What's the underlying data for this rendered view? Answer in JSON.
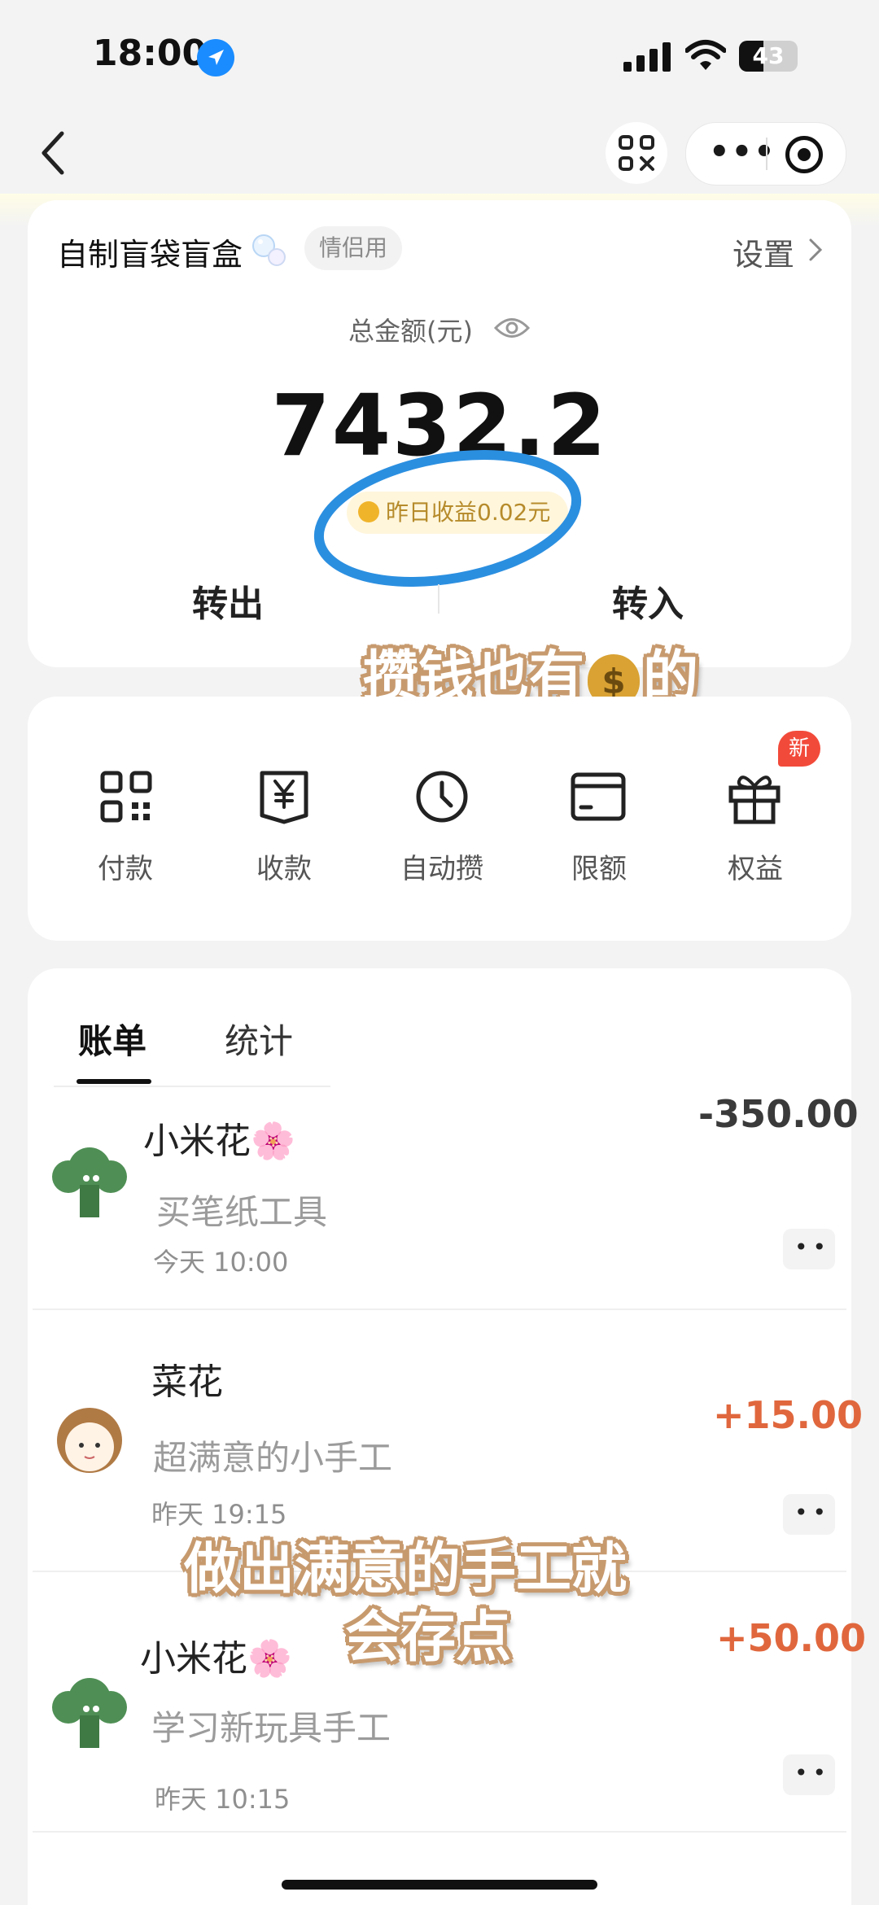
{
  "status_bar": {
    "time": "18:00",
    "battery": "43"
  },
  "account": {
    "name": "自制盲袋盲盒",
    "tag": "情侣用",
    "settings_label": "设置",
    "total_label": "总金额(元)",
    "total_amount": "7432.2",
    "yesterday_yield": "昨日收益0.02元",
    "transfer_out": "转出",
    "transfer_in": "转入"
  },
  "captions": {
    "line1_pre": "攒钱也有",
    "line1_post": "的",
    "line2": "做出满意的手工就",
    "line3": "会存点"
  },
  "quick_actions": [
    {
      "label": "付款",
      "icon": "qr-code-icon"
    },
    {
      "label": "收款",
      "icon": "receipt-yen-icon"
    },
    {
      "label": "自动攒",
      "icon": "clock-icon"
    },
    {
      "label": "限额",
      "icon": "card-icon"
    },
    {
      "label": "权益",
      "icon": "gift-icon"
    }
  ],
  "new_badge": "新",
  "tabs": [
    {
      "label": "账单"
    },
    {
      "label": "统计"
    }
  ],
  "transactions": [
    {
      "name": "小米花🌸",
      "note": "买笔纸工具",
      "time": "今天 10:00",
      "amount": "-350.00"
    },
    {
      "name": "菜花",
      "note": "超满意的小手工",
      "time": "昨天 19:15",
      "amount": "+15.00"
    },
    {
      "name": "小米花🌸",
      "note": "学习新玩具手工",
      "time": "昨天 10:15",
      "amount": "+50.00"
    }
  ],
  "colors": {
    "positive": "#e0673d",
    "negative": "#3a3a3a",
    "annotation": "#2b8fe0"
  }
}
